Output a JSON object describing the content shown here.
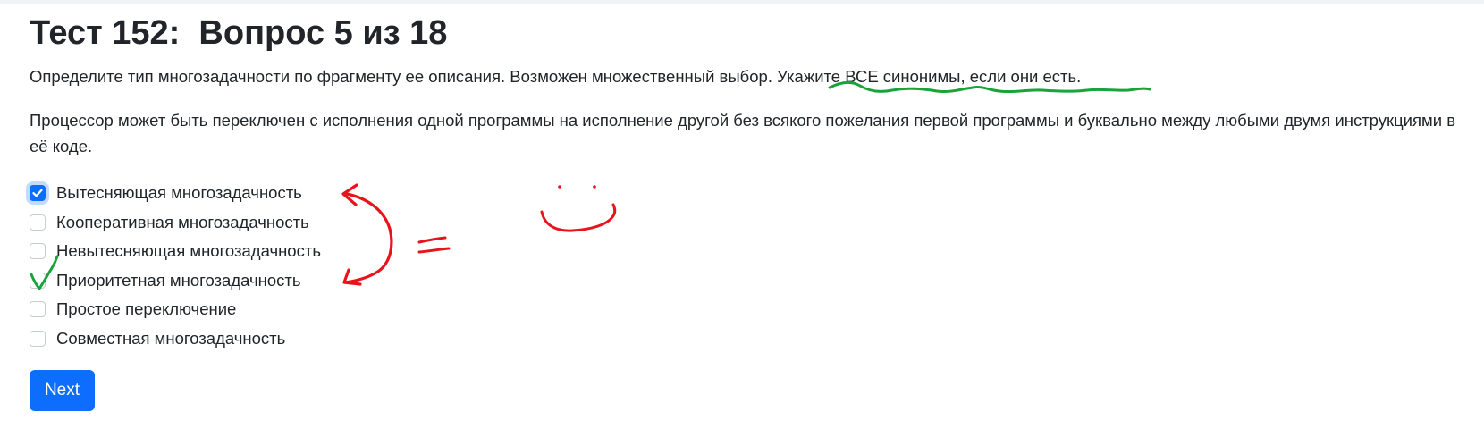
{
  "quiz": {
    "title": "Тест 152:  Вопрос 5 из 18",
    "instruction": "Определите тип многозадачности по фрагменту ее описания. Возможен множественный выбор. Укажите ВСЕ синонимы, если они есть.",
    "question": "Процессор может быть переключен с исполнения одной программы на исполнение другой без всякого пожелания первой программы и буквально между любыми двумя инструкциями в её коде.",
    "options": [
      {
        "label": "Вытесняющая многозадачность",
        "checked": true
      },
      {
        "label": "Кооперативная многозадачность",
        "checked": false
      },
      {
        "label": "Невытесняющая многозадачность",
        "checked": false
      },
      {
        "label": "Приоритетная многозадачность",
        "checked": false
      },
      {
        "label": "Простое переключение",
        "checked": false
      },
      {
        "label": "Совместная многозадачность",
        "checked": false
      }
    ],
    "next_label": "Next"
  },
  "annotations": {
    "equals_text": "=",
    "red_color": "#e8141b",
    "green_color": "#19a33a"
  },
  "colors": {
    "accent": "#0d6efd",
    "text": "#212529"
  }
}
